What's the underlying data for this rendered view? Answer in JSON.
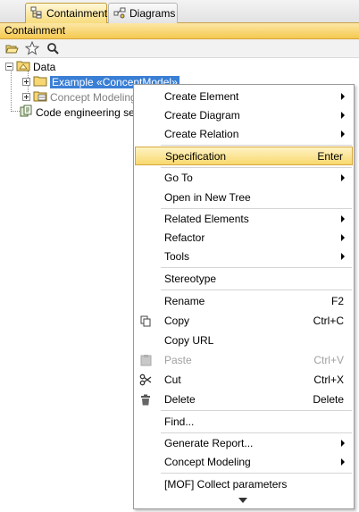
{
  "tabs": [
    {
      "label": "Containment",
      "icon": "containment-tree-icon"
    },
    {
      "label": "Diagrams",
      "icon": "diagrams-icon"
    }
  ],
  "panel": {
    "title": "Containment"
  },
  "toolbar": {
    "icons": [
      "open-folder-icon",
      "star-icon",
      "search-icon"
    ]
  },
  "tree": {
    "root": "Data",
    "items": [
      {
        "label": "Example «ConceptModel»",
        "selected": true
      },
      {
        "label": "Concept Modeling Profile",
        "visible_text": "Concept Modeling I"
      },
      {
        "label": "Code engineering sets"
      }
    ]
  },
  "menu": {
    "items": [
      {
        "label": "Create Element",
        "submenu": true
      },
      {
        "label": "Create Diagram",
        "submenu": true
      },
      {
        "label": "Create Relation",
        "submenu": true
      },
      {
        "label": "Specification",
        "shortcut": "Enter",
        "highlighted": true
      },
      {
        "label": "Go To",
        "submenu": true
      },
      {
        "label": "Open in New Tree"
      },
      {
        "label": "Related Elements",
        "submenu": true
      },
      {
        "label": "Refactor",
        "submenu": true
      },
      {
        "label": "Tools",
        "submenu": true
      },
      {
        "label": "Stereotype"
      },
      {
        "label": "Rename",
        "shortcut": "F2"
      },
      {
        "label": "Copy",
        "shortcut": "Ctrl+C",
        "icon": "copy-icon"
      },
      {
        "label": "Copy URL"
      },
      {
        "label": "Paste",
        "shortcut": "Ctrl+V",
        "icon": "paste-icon",
        "disabled": true
      },
      {
        "label": "Cut",
        "shortcut": "Ctrl+X",
        "icon": "cut-icon"
      },
      {
        "label": "Delete",
        "shortcut": "Delete",
        "icon": "delete-icon"
      },
      {
        "label": "Find..."
      },
      {
        "label": "Generate Report...",
        "submenu": true
      },
      {
        "label": "Concept Modeling",
        "submenu": true
      },
      {
        "label": "[MOF] Collect parameters"
      }
    ]
  },
  "colors": {
    "accent_yellow": "#f5c94f",
    "selection_blue": "#3a7fd5",
    "menu_highlight": "#f8d86e"
  }
}
